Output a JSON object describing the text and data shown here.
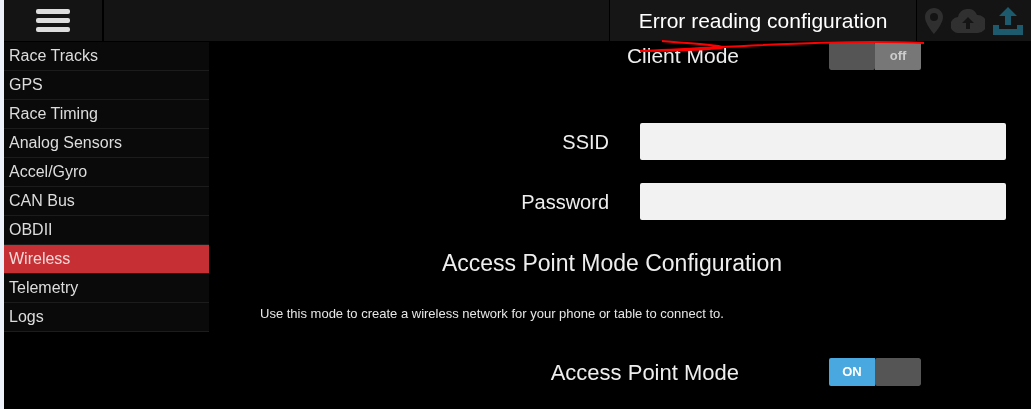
{
  "top_bar": {
    "status_message": "Error reading configuration"
  },
  "sidebar": {
    "items": [
      {
        "label": "Race Tracks",
        "selected": false
      },
      {
        "label": "GPS",
        "selected": false
      },
      {
        "label": "Race Timing",
        "selected": false
      },
      {
        "label": "Analog Sensors",
        "selected": false
      },
      {
        "label": "Accel/Gyro",
        "selected": false
      },
      {
        "label": "CAN Bus",
        "selected": false
      },
      {
        "label": "OBDII",
        "selected": false
      },
      {
        "label": "Wireless",
        "selected": true
      },
      {
        "label": "Telemetry",
        "selected": false
      },
      {
        "label": "Logs",
        "selected": false
      }
    ]
  },
  "client_mode": {
    "label": "Client Mode",
    "toggle": {
      "on": false,
      "label": "off"
    }
  },
  "fields": [
    {
      "label": "SSID"
    },
    {
      "label": "Password"
    }
  ],
  "access_point": {
    "heading": "Access Point Mode Configuration",
    "description": "Use this mode to create a wireless network for your phone or table to connect to.",
    "mode_label": "Access Point Mode",
    "toggle": {
      "on": true,
      "label": "ON"
    }
  }
}
